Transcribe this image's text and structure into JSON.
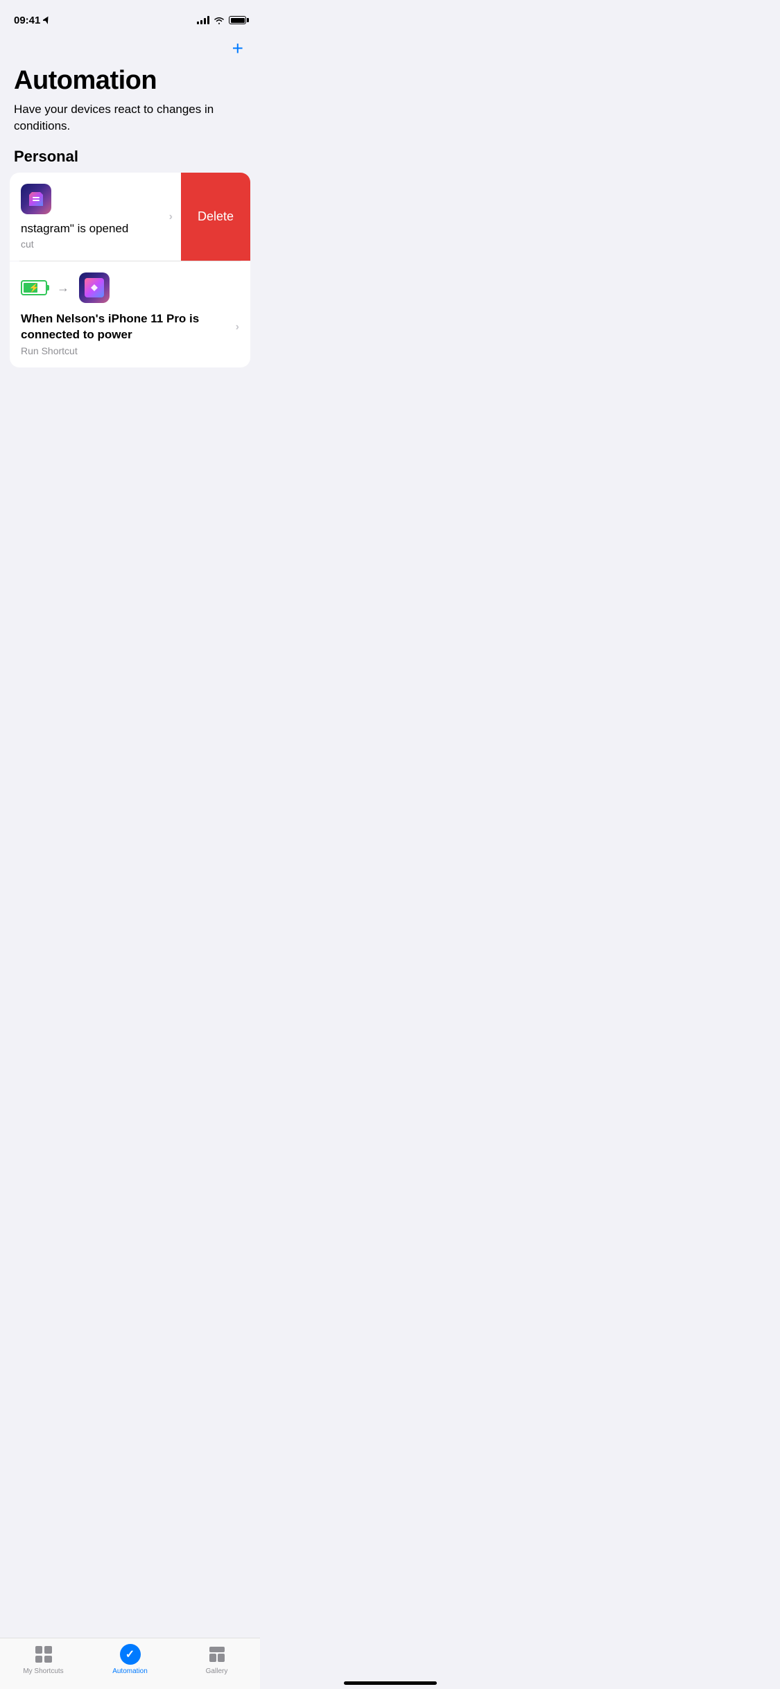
{
  "statusBar": {
    "time": "09:41",
    "locationArrow": "›"
  },
  "header": {
    "addButtonLabel": "+"
  },
  "page": {
    "title": "Automation",
    "subtitle": "Have your devices react to changes in conditions."
  },
  "sections": [
    {
      "label": "Personal",
      "items": [
        {
          "id": "item1",
          "triggerText": "",
          "title": "nstagram\" is opened",
          "subtitle": "cut",
          "hasDeleteVisible": true,
          "deleteLabel": "Delete"
        },
        {
          "id": "item2",
          "title": "When Nelson's iPhone 11 Pro is connected to power",
          "subtitle": "Run Shortcut",
          "hasDeleteVisible": false
        }
      ]
    }
  ],
  "tabBar": {
    "tabs": [
      {
        "id": "my-shortcuts",
        "label": "My Shortcuts",
        "active": false
      },
      {
        "id": "automation",
        "label": "Automation",
        "active": true
      },
      {
        "id": "gallery",
        "label": "Gallery",
        "active": false
      }
    ]
  }
}
